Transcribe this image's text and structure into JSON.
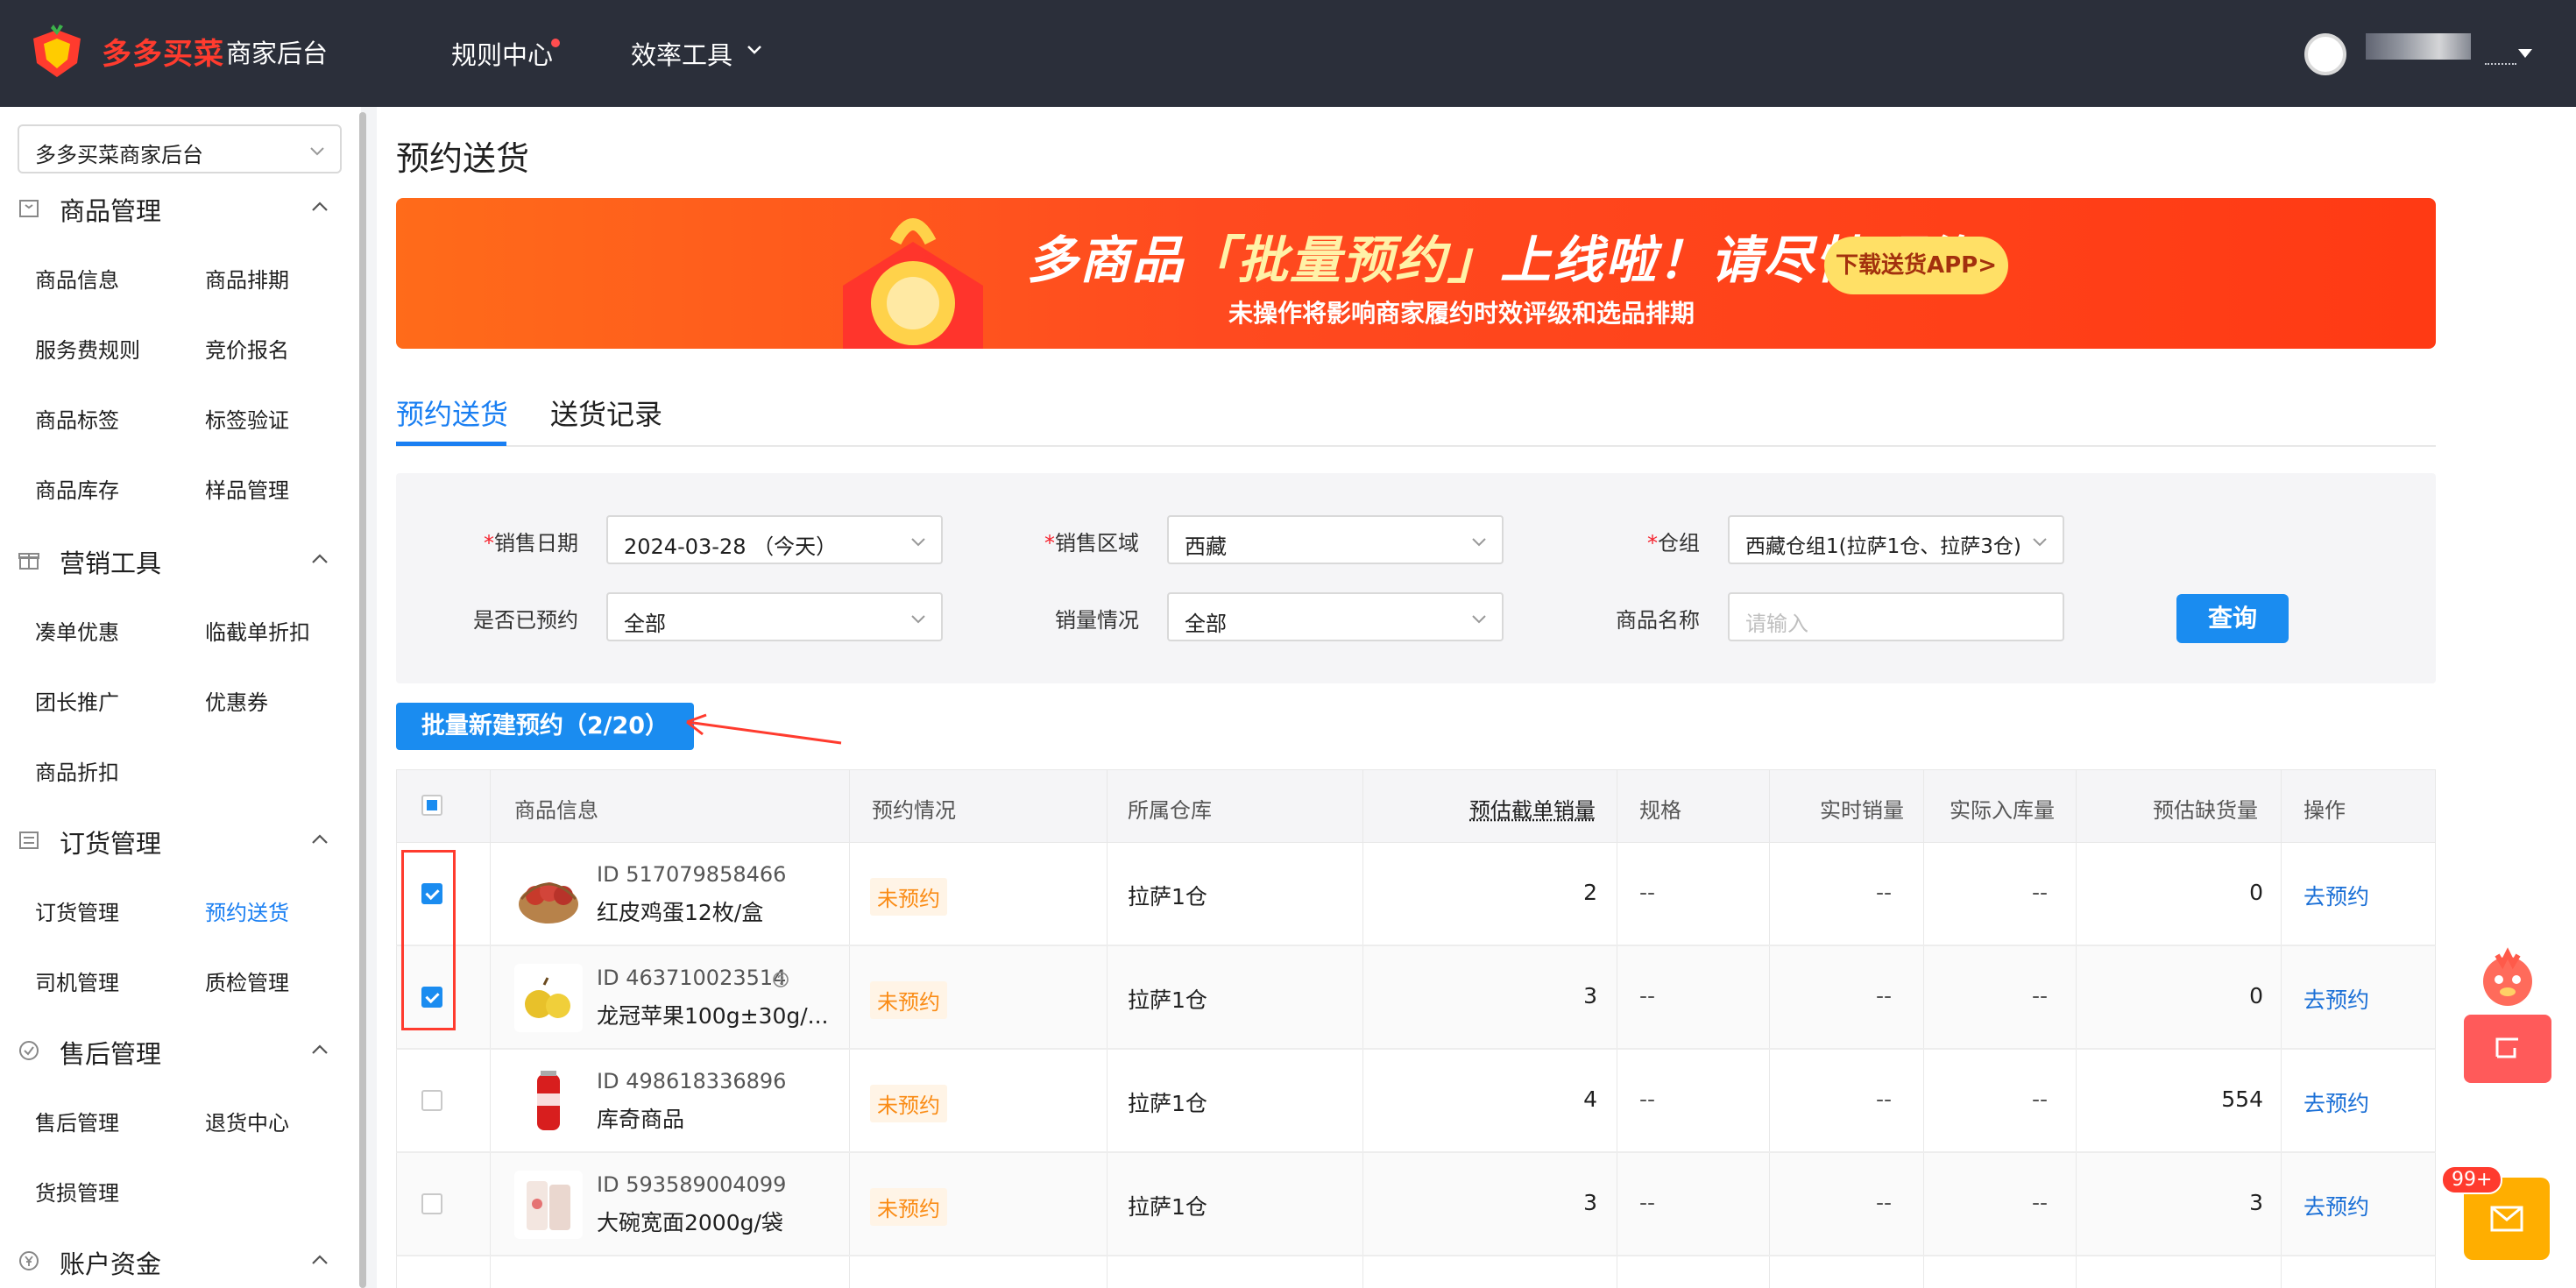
{
  "app": {
    "brand": "多多买菜",
    "brand_sub": "商家后台",
    "nav_rules": "规则中心",
    "nav_tools": "效率工具"
  },
  "sidebar": {
    "shop_selector": "多多买菜商家后台",
    "groups": [
      {
        "title": "商品管理",
        "items": [
          "商品信息",
          "商品排期",
          "服务费规则",
          "竞价报名",
          "商品标签",
          "标签验证",
          "商品库存",
          "样品管理"
        ]
      },
      {
        "title": "营销工具",
        "items": [
          "凑单优惠",
          "临截单折扣",
          "团长推广",
          "优惠券",
          "商品折扣"
        ]
      },
      {
        "title": "订货管理",
        "items": [
          "订货管理",
          "预约送货",
          "司机管理",
          "质检管理"
        ]
      },
      {
        "title": "售后管理",
        "items": [
          "售后管理",
          "退货中心",
          "货损管理"
        ]
      },
      {
        "title": "账户资金",
        "items": []
      }
    ],
    "active_item": "预约送货"
  },
  "page": {
    "title": "预约送货",
    "banner": {
      "title_part1": "多商品",
      "title_highlight": "「批量预约」",
      "title_part2": "上线啦！请尽快预约",
      "subtitle": "未操作将影响商家履约时效评级和选品排期",
      "button": "下载送货APP>"
    },
    "tabs": [
      "预约送货",
      "送货记录"
    ]
  },
  "filters": {
    "sale_date_label": "销售日期",
    "sale_date_value": "2024-03-28 （今天）",
    "sale_region_label": "销售区域",
    "sale_region_value": "西藏",
    "warehouse_group_label": "仓组",
    "warehouse_group_value": "西藏仓组1(拉萨1仓、拉萨3仓)",
    "booked_label": "是否已预约",
    "booked_value": "全部",
    "sales_label": "销量情况",
    "sales_value": "全部",
    "product_name_label": "商品名称",
    "product_name_placeholder": "请输入",
    "query_button": "查询"
  },
  "batch_button": "批量新建预约（2/20）",
  "table": {
    "headers": [
      "商品信息",
      "预约情况",
      "所属仓库",
      "预估截单销量",
      "规格",
      "实时销量",
      "实际入库量",
      "预估缺货量",
      "操作"
    ],
    "rows": [
      {
        "id": "ID 517079858466",
        "name": "红皮鸡蛋12枚/盒",
        "status": "未预约",
        "warehouse": "拉萨1仓",
        "est_sales": "2",
        "spec": "--",
        "realtime": "--",
        "inbound": "--",
        "shortage": "0",
        "action": "去预约",
        "checked": true
      },
      {
        "id": "ID 463710023514",
        "name": "龙冠苹果100g±30g/...",
        "status": "未预约",
        "warehouse": "拉萨1仓",
        "est_sales": "3",
        "spec": "--",
        "realtime": "--",
        "inbound": "--",
        "shortage": "0",
        "action": "去预约",
        "checked": true
      },
      {
        "id": "ID 498618336896",
        "name": "库奇商品",
        "status": "未预约",
        "warehouse": "拉萨1仓",
        "est_sales": "4",
        "spec": "--",
        "realtime": "--",
        "inbound": "--",
        "shortage": "554",
        "action": "去预约",
        "checked": false
      },
      {
        "id": "ID 593589004099",
        "name": "大碗宽面2000g/袋",
        "status": "未预约",
        "warehouse": "拉萨1仓",
        "est_sales": "3",
        "spec": "--",
        "realtime": "--",
        "inbound": "--",
        "shortage": "3",
        "action": "去预约",
        "checked": false
      }
    ]
  },
  "floating": {
    "badge": "99+"
  },
  "colors": {
    "accent": "#1a8cf0",
    "brand_red": "#ff3b2e",
    "topbar": "#2b2f3a",
    "status_orange": "#fa8c16"
  }
}
